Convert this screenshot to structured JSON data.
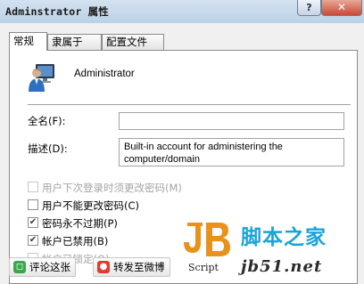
{
  "window": {
    "title": "Adminstrator 属性",
    "help_label": "?",
    "close_label": "✕"
  },
  "tabs": [
    {
      "label": "常规",
      "active": true
    },
    {
      "label": "隶属于",
      "active": false
    },
    {
      "label": "配置文件",
      "active": false
    }
  ],
  "general": {
    "user_icon": "user-monitor-icon",
    "username": "Administrator",
    "fullname_label": "全名(F):",
    "fullname_value": "",
    "description_label": "描述(D):",
    "description_line1": "Built-in account for administering the",
    "description_line2": "computer/domain",
    "checkboxes": [
      {
        "label": "用户下次登录时须更改密码(M)",
        "checked": false,
        "enabled": false
      },
      {
        "label": "用户不能更改密码(C)",
        "checked": false,
        "enabled": true
      },
      {
        "label": "密码永不过期(P)",
        "checked": true,
        "enabled": true
      },
      {
        "label": "帐户已禁用(B)",
        "checked": true,
        "enabled": true
      },
      {
        "label": "帐户已锁定(O)",
        "checked": false,
        "enabled": false
      }
    ]
  },
  "share": {
    "comment_label": "评论这张",
    "forward_label": "转发至微博"
  },
  "watermark": {
    "script_text": "Script",
    "site_name": "脚本之家",
    "site_url": "jb51.net"
  },
  "colors": {
    "watermark_blue": "#1aa3d8",
    "logo_orange": "#e8921c",
    "close_red": "#c84a35"
  }
}
